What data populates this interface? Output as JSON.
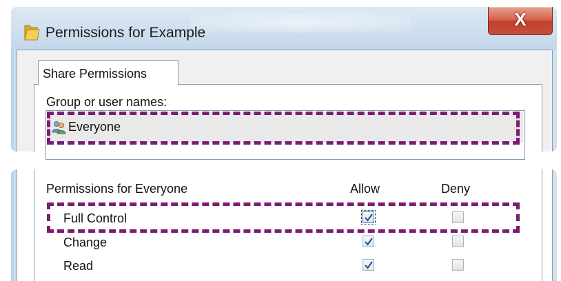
{
  "window": {
    "title": "Permissions for Example",
    "close_glyph": "X",
    "icon": "folder-icon"
  },
  "tabs": [
    {
      "label": "Share Permissions",
      "selected": true
    }
  ],
  "group_section": {
    "label": "Group or user names:",
    "users": [
      {
        "name": "Everyone",
        "icon": "users-icon",
        "selected": true
      }
    ]
  },
  "permissions": {
    "header": "Permissions for Everyone",
    "allow_label": "Allow",
    "deny_label": "Deny",
    "rows": [
      {
        "name": "Full Control",
        "allow": true,
        "deny": false,
        "focused": true
      },
      {
        "name": "Change",
        "allow": true,
        "deny": false
      },
      {
        "name": "Read",
        "allow": true,
        "deny": false
      }
    ]
  },
  "colors": {
    "highlight": "#7b1c73",
    "close_button": "#c84f38",
    "checkmark": "#1c4f8f"
  }
}
